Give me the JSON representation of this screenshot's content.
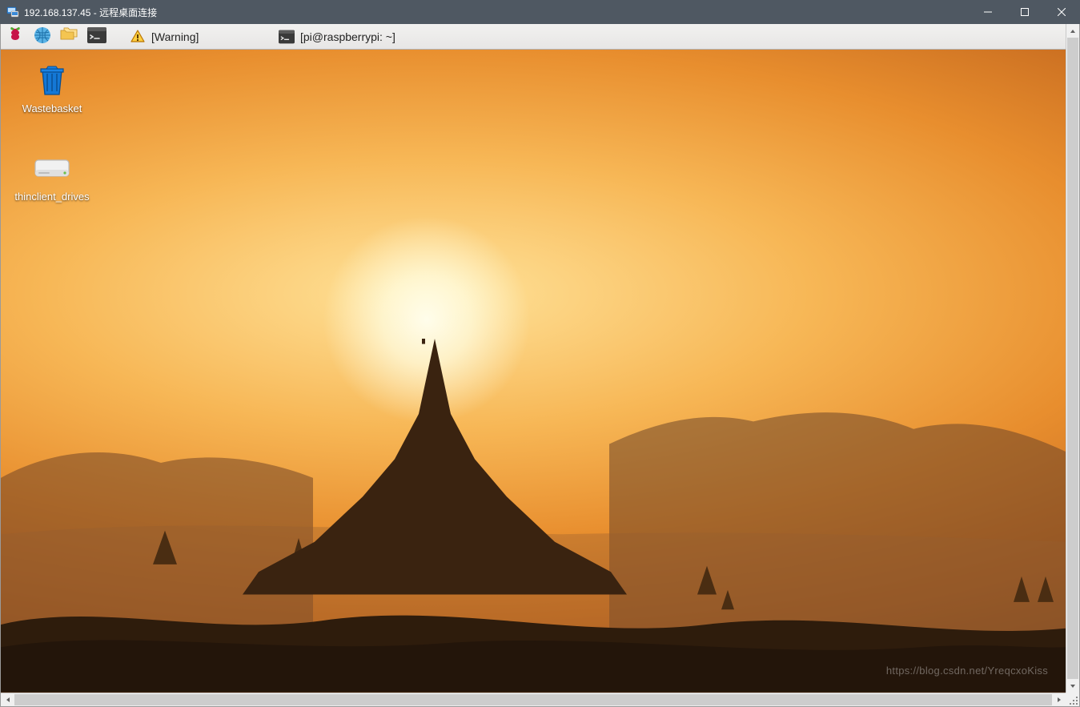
{
  "window": {
    "title": "192.168.137.45 - 远程桌面连接"
  },
  "panel": {
    "tasks": [
      {
        "label": "[Warning]",
        "icon": "warning-icon",
        "active": false
      },
      {
        "label": "[pi@raspberrypi: ~]",
        "icon": "terminal-icon",
        "active": true
      }
    ]
  },
  "desktop": {
    "icons": [
      {
        "label": "Wastebasket",
        "icon": "trash-icon"
      },
      {
        "label": "thinclient_drives",
        "icon": "drive-icon"
      }
    ]
  },
  "watermark": "https://blog.csdn.net/YreqcxoKiss"
}
